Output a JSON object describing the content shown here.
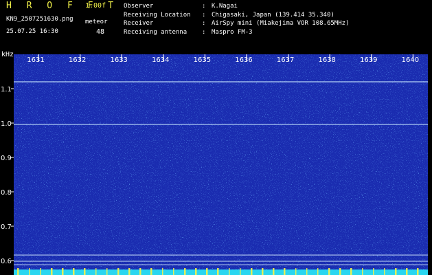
{
  "header": {
    "title": "H R O F F T",
    "version": "1.00f",
    "filename": "KN9_2507251630.png",
    "datetime": "25.07.25 16:30",
    "meteor_label": "meteor",
    "meteor_count": "48"
  },
  "info": [
    {
      "label": "Observer",
      "value": "K.Nagai"
    },
    {
      "label": "Receiving Location",
      "value": "Chigasaki, Japan (139.414 35.340)"
    },
    {
      "label": "Receiver",
      "value": "AirSpy mini (Miakejima VOR 108.65MHz)"
    },
    {
      "label": "Receiving antenna",
      "value": "Maspro FM-3"
    }
  ],
  "separator": ":",
  "axis": {
    "y_unit": "kHz",
    "y_ticks": [
      "1.1",
      "1.0",
      "0.9",
      "0.8",
      "0.7",
      "0.6"
    ],
    "x_ticks": [
      "1631",
      "1632",
      "1633",
      "1634",
      "1635",
      "1636",
      "1637",
      "1638",
      "1639",
      "1640"
    ]
  },
  "colors": {
    "background": "#1a2cb0",
    "header_text": "#f2f24a",
    "bottom_band": "#29d6f0"
  }
}
